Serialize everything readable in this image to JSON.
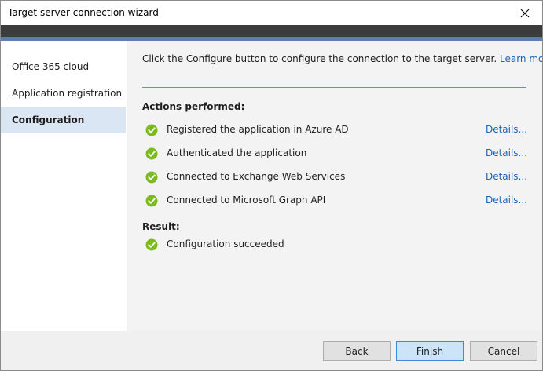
{
  "window": {
    "title": "Target server connection wizard"
  },
  "sidebar": {
    "items": [
      {
        "label": "Office 365 cloud"
      },
      {
        "label": "Application registration"
      },
      {
        "label": "Configuration",
        "selected": true
      }
    ]
  },
  "main": {
    "intro_text": "Click the Configure button to configure the connection to the target server.",
    "learn_more": "Learn more.",
    "actions_title": "Actions performed:",
    "actions": [
      {
        "label": "Registered the application in Azure AD",
        "details": "Details..."
      },
      {
        "label": "Authenticated the application",
        "details": "Details..."
      },
      {
        "label": "Connected to Exchange Web Services",
        "details": "Details..."
      },
      {
        "label": "Connected to Microsoft Graph API",
        "details": "Details..."
      }
    ],
    "result_title": "Result:",
    "result": "Configuration succeeded"
  },
  "footer": {
    "back": "Back",
    "finish": "Finish",
    "cancel": "Cancel"
  },
  "colors": {
    "check": "#7cbb1e",
    "link": "#1a65b8",
    "selected_nav": "#dbe6f4",
    "header_band": "#3c3c3c",
    "accent_stripe": "#5d7daa"
  }
}
